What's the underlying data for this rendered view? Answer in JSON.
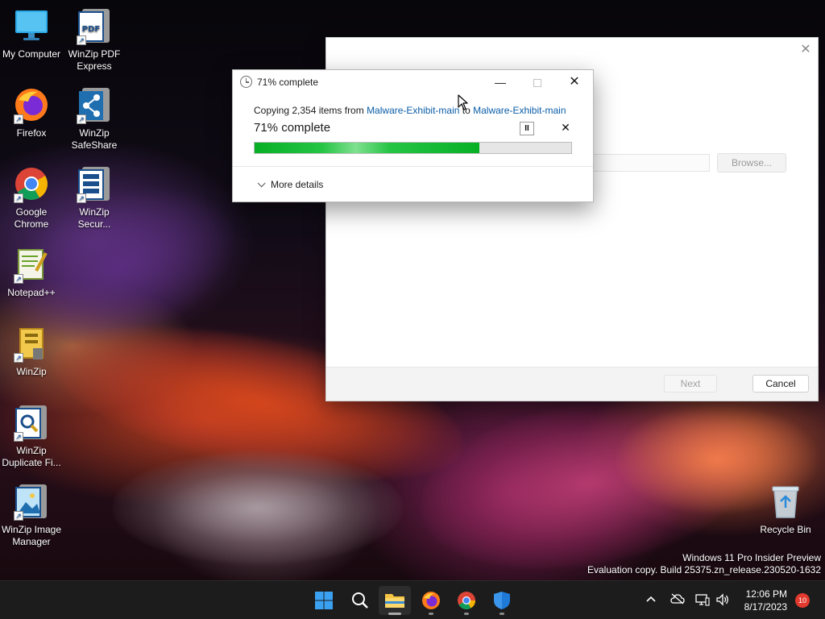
{
  "desktop": {
    "icons": [
      {
        "label": "My Computer"
      },
      {
        "label": "WinZip PDF Express"
      },
      {
        "label": "Firefox"
      },
      {
        "label": "WinZip SafeShare"
      },
      {
        "label": "Google Chrome"
      },
      {
        "label": "WinZip Secur..."
      },
      {
        "label": "Notepad++"
      },
      {
        "label": "WinZip"
      },
      {
        "label": "WinZip Duplicate Fi..."
      },
      {
        "label": "WinZip Image Manager"
      },
      {
        "label": "Recycle Bin"
      }
    ],
    "watermark": {
      "line1": "Windows 11 Pro Insider Preview",
      "line2": "Evaluation copy. Build 25375.zn_release.230520-1632"
    }
  },
  "wizard": {
    "browse_label": "Browse...",
    "next_label": "Next",
    "cancel_label": "Cancel"
  },
  "copy_dialog": {
    "title": "71% complete",
    "copy_prefix": "Copying 2,354 items from ",
    "source": "Malware-Exhibit-main",
    "to_word": " to ",
    "destination": "Malware-Exhibit-main",
    "heading": "71% complete",
    "progress": 0.71,
    "pause_glyph": "II",
    "stop_glyph": "✕",
    "more_details_label": "More details",
    "minimize_glyph": "—",
    "close_glyph": "✕"
  },
  "taskbar": {
    "apps": [
      "start-icon",
      "search-icon",
      "file-explorer-icon",
      "firefox-icon",
      "chrome-icon",
      "defender-icon"
    ],
    "clock_time": "12:06 PM",
    "clock_date": "8/17/2023",
    "notification_count": "10"
  },
  "colors": {
    "accent_link": "#0a5da8",
    "progress_green": "#06b025",
    "taskbar_bg": "#1c1c1c",
    "badge_red": "#e23a2e"
  }
}
